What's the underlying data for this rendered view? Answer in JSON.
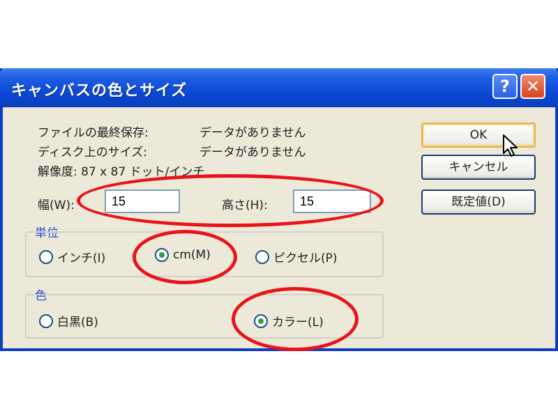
{
  "window": {
    "title": "キャンバスの色とサイズ",
    "help_label": "?",
    "close_label": "✕"
  },
  "info": {
    "last_saved_label": "ファイルの最終保存:",
    "last_saved_value": "データがありません",
    "disk_size_label": "ディスク上のサイズ:",
    "disk_size_value": "データがありません",
    "resolution_text": "解像度: 87 x 87 ドット/インチ"
  },
  "size": {
    "width_label": "幅(W):",
    "width_value": "15",
    "height_label": "高さ(H):",
    "height_value": "15"
  },
  "units": {
    "group_label": "単位",
    "options": [
      {
        "label": "インチ(I)",
        "checked": false
      },
      {
        "label": "cm(M)",
        "checked": true
      },
      {
        "label": "ピクセル(P)",
        "checked": false
      }
    ]
  },
  "color": {
    "group_label": "色",
    "options": [
      {
        "label": "白黒(B)",
        "checked": false
      },
      {
        "label": "カラー(L)",
        "checked": true
      }
    ]
  },
  "buttons": {
    "ok_label": "OK",
    "cancel_label": "キャンセル",
    "default_label": "既定値(D)"
  },
  "colors": {
    "titlebar": "#0b46d2",
    "highlight": "#e8131b",
    "radio_checked": "#2ea03c",
    "group_label": "#1f4fd0"
  },
  "icons": {
    "cursor": "mouse-pointer-icon"
  }
}
